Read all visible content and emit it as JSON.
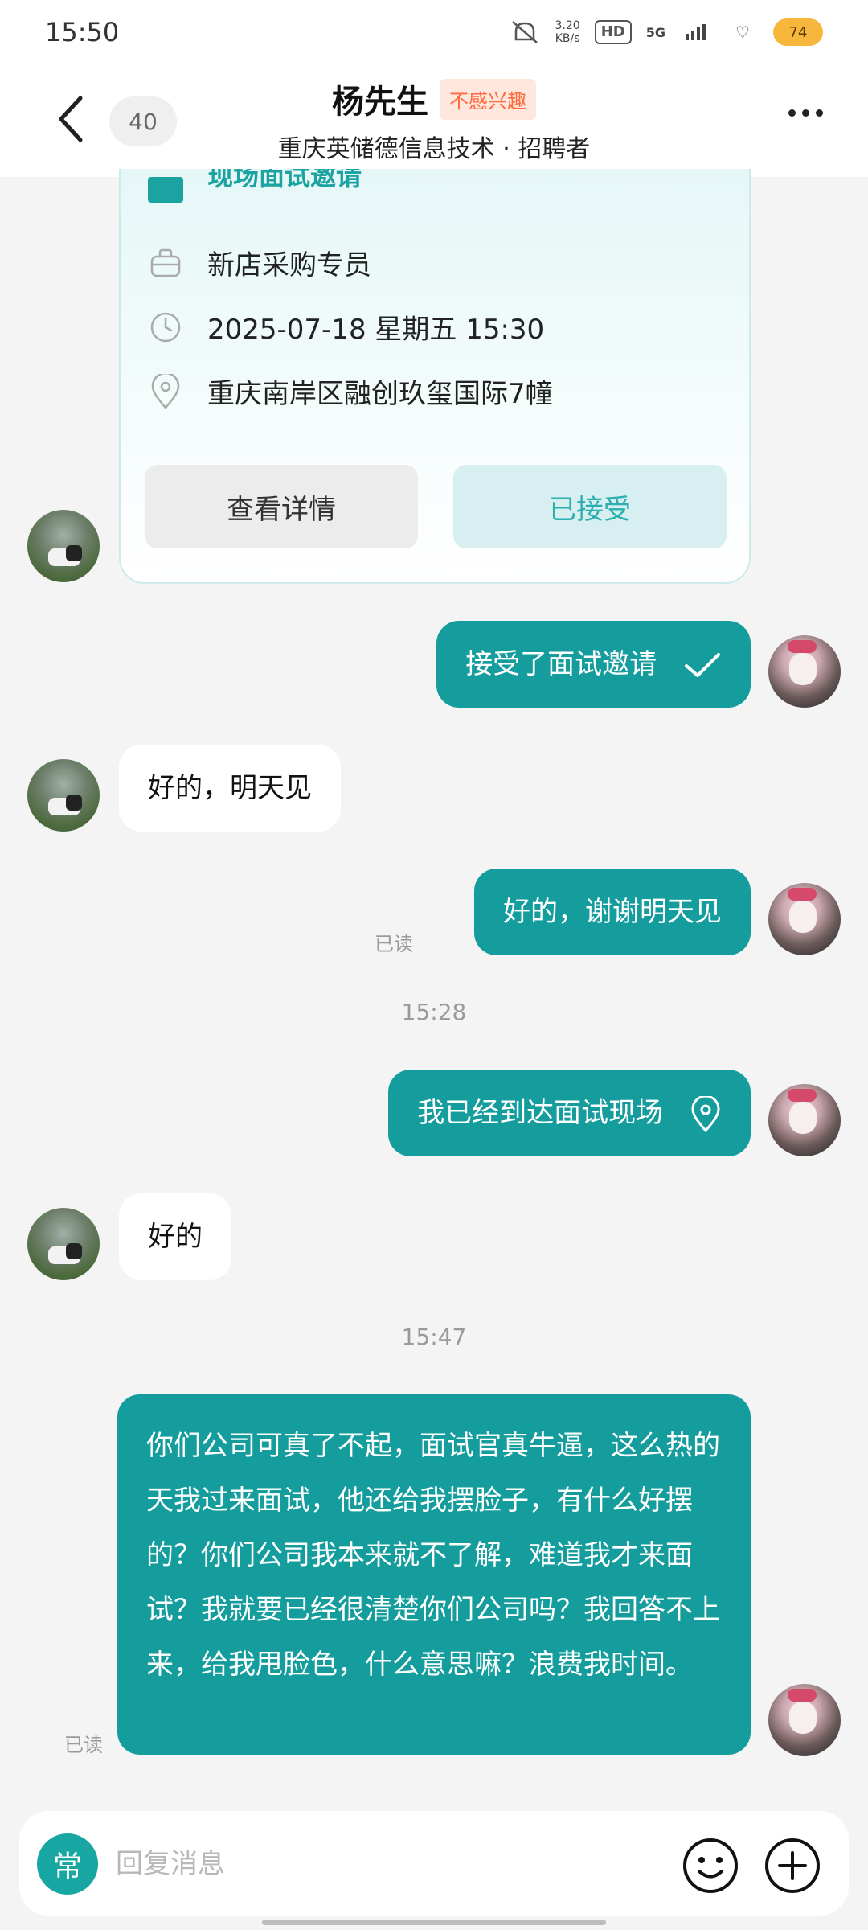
{
  "status_bar": {
    "time": "15:50",
    "net_speed_value": "3.20",
    "net_speed_unit": "KB/s",
    "hd_label": "HD",
    "network_label": "5G",
    "battery_level": "74"
  },
  "header": {
    "unread_count": "40",
    "contact_name": "杨先生",
    "tag": "不感兴趣",
    "subtitle": "重庆英储德信息技术 · 招聘者"
  },
  "interview_card": {
    "title": "现场面试邀请",
    "position": "新店采购专员",
    "datetime": "2025-07-18 星期五 15:30",
    "location": "重庆南岸区融创玖玺国际7幢",
    "detail_button": "查看详情",
    "accepted_button": "已接受"
  },
  "messages": [
    {
      "side": "out",
      "text": "接受了面试邀请"
    },
    {
      "side": "in",
      "text": "好的，明天见"
    },
    {
      "side": "out",
      "text": "好的，谢谢明天见",
      "read": "已读"
    },
    {
      "type": "time",
      "text": "15:28"
    },
    {
      "side": "out",
      "text": "我已经到达面试现场"
    },
    {
      "side": "in",
      "text": "好的"
    },
    {
      "type": "time",
      "text": "15:47"
    },
    {
      "side": "out",
      "text": "你们公司可真了不起，面试官真牛逼，这么热的天我过来面试，他还给我摆脸子，有什么好摆的？你们公司我本来就不了解，难道我才来面试？我就要已经很清楚你们公司吗？我回答不上来，给我甩脸色，什么意思嘛？浪费我时间。",
      "read": "已读"
    }
  ],
  "input_bar": {
    "common_phrases_label": "常",
    "placeholder": "回复消息"
  },
  "colors": {
    "accent": "#159d9d",
    "tag_text": "#ff6a3d",
    "tag_bg": "#ffe7dd"
  },
  "icons": [
    "back-arrow-icon",
    "more-icon",
    "briefcase-icon",
    "clock-icon",
    "location-pin-icon",
    "checkmark-icon",
    "emoji-icon",
    "plus-icon"
  ]
}
